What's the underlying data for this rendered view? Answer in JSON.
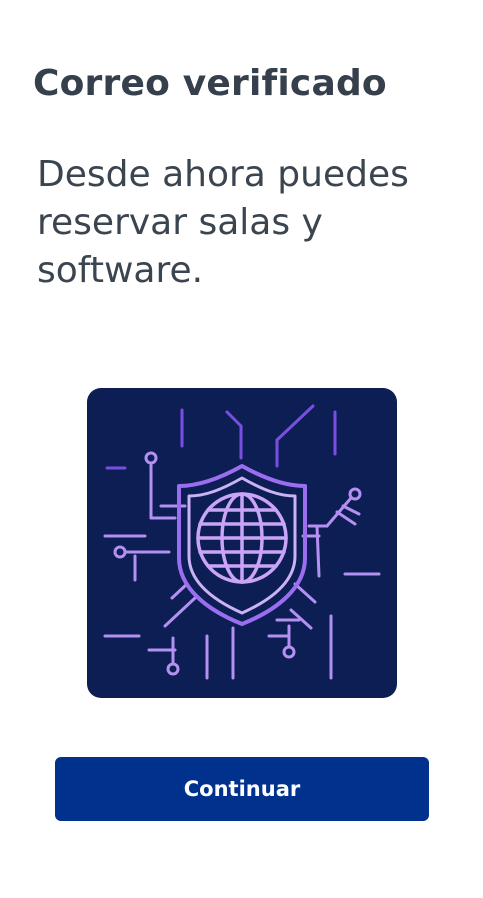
{
  "header": {
    "title": "Correo verificado"
  },
  "main": {
    "message": "Desde ahora puedes reservar salas y software.",
    "illustration_icon": "security-globe-circuit-icon"
  },
  "actions": {
    "continue_label": "Continuar"
  },
  "colors": {
    "title_text": "#35404c",
    "body_text": "#3b4550",
    "illustration_background": "#0d1e54",
    "illustration_primary": "#9b6ef0",
    "illustration_secondary": "#c9b2f5",
    "button_background": "#00318c",
    "button_text": "#ffffff"
  }
}
